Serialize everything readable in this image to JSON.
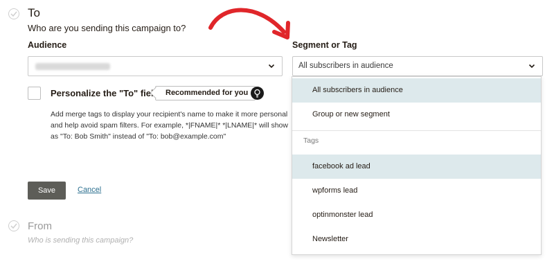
{
  "to_section": {
    "title": "To",
    "subtitle": "Who are you sending this campaign to?",
    "audience_label": "Audience",
    "audience_value": "",
    "segment_label": "Segment or Tag",
    "segment_value": "All subscribers in audience"
  },
  "personalize": {
    "label": "Personalize the \"To\" field",
    "recommended": "Recommended for you",
    "help_text": "Add merge tags to display your recipient's name to make it more personal and help avoid spam filters. For example, *|FNAME|* *|LNAME|* will show as \"To: Bob Smith\" instead of \"To: bob@example.com\""
  },
  "actions": {
    "save_label": "Save",
    "cancel_label": "Cancel"
  },
  "from_section": {
    "title": "From",
    "subtitle": "Who is sending this campaign?"
  },
  "dropdown": {
    "options": [
      {
        "label": "All subscribers in audience",
        "highlighted": true
      },
      {
        "label": "Group or new segment",
        "highlighted": false
      }
    ],
    "tags_header": "Tags",
    "tags": [
      {
        "label": "facebook ad lead",
        "highlighted": true
      },
      {
        "label": "wpforms lead",
        "highlighted": false
      },
      {
        "label": "optinmonster lead",
        "highlighted": false
      },
      {
        "label": "Newsletter",
        "highlighted": false
      }
    ]
  },
  "icons": {
    "step_check": "check-circle-icon",
    "chevron": "chevron-down-icon",
    "bulb": "lightbulb-icon",
    "arrow": "red-arrow-annotation"
  },
  "colors": {
    "save_button": "#5d5d58",
    "cancel_link": "#2b6f8f",
    "highlight": "#dde9ec",
    "arrow": "#e0262a"
  }
}
